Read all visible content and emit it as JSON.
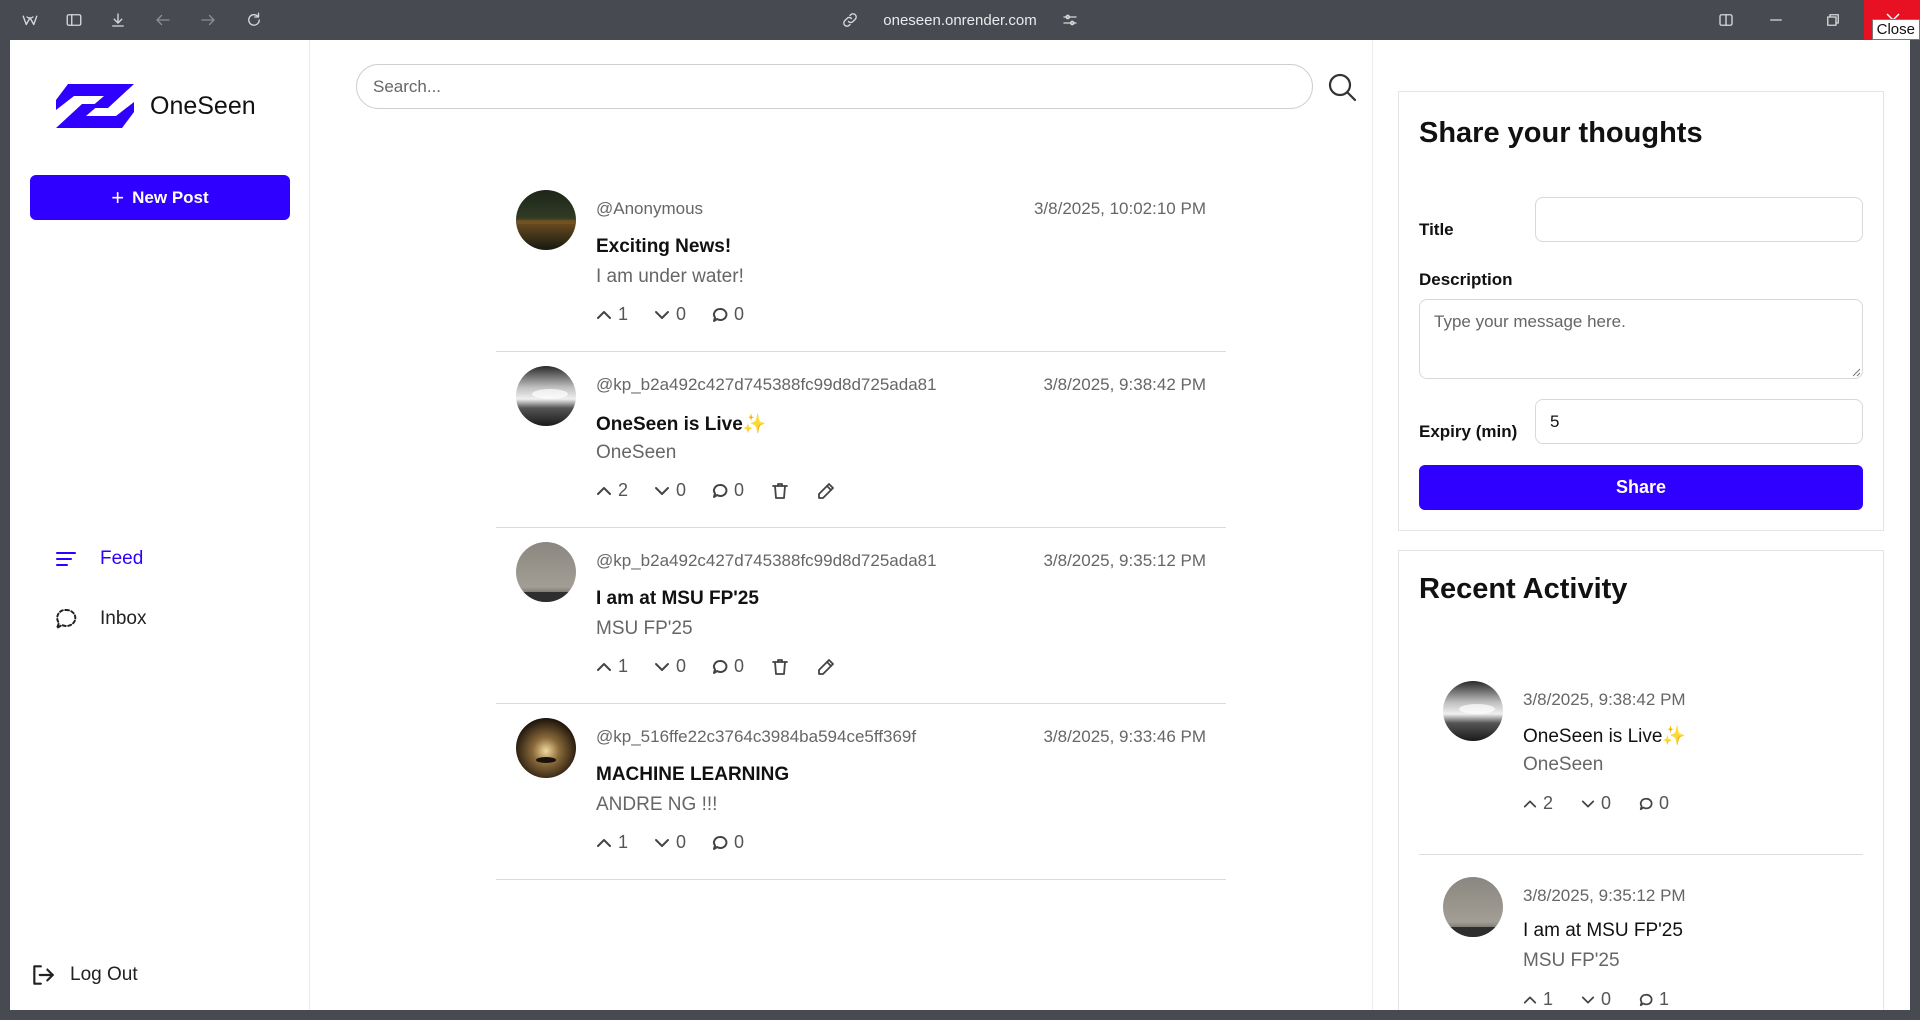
{
  "browser": {
    "url": "oneseen.onrender.com",
    "close_tooltip": "Close",
    "colors": {
      "chrome": "#474b51",
      "close": "#e81123"
    }
  },
  "sidebar": {
    "brand": "OneSeen",
    "new_post_label": "New Post",
    "nav": [
      {
        "label": "Feed",
        "icon": "menu-lines-icon",
        "active": true
      },
      {
        "label": "Inbox",
        "icon": "chat-bubble-icon",
        "active": false
      }
    ],
    "logout_label": "Log Out"
  },
  "search": {
    "placeholder": "Search..."
  },
  "posts": [
    {
      "author": "@Anonymous",
      "time": "3/8/2025, 10:02:10 PM",
      "title": "Exciting News!",
      "description": "I am under water!",
      "upvotes": "1",
      "downvotes": "0",
      "comments": "0",
      "can_edit": false
    },
    {
      "author": "@kp_b2a492c427d745388fc99d8d725ada81",
      "time": "3/8/2025, 9:38:42 PM",
      "title": "OneSeen is Live✨",
      "description": "OneSeen",
      "upvotes": "2",
      "downvotes": "0",
      "comments": "0",
      "can_edit": true
    },
    {
      "author": "@kp_b2a492c427d745388fc99d8d725ada81",
      "time": "3/8/2025, 9:35:12 PM",
      "title": "I am at MSU FP'25",
      "description": "MSU FP'25",
      "upvotes": "1",
      "downvotes": "0",
      "comments": "0",
      "can_edit": true
    },
    {
      "author": "@kp_516ffe22c3764c3984ba594ce5ff369f",
      "time": "3/8/2025, 9:33:46 PM",
      "title": "MACHINE LEARNING",
      "description": "ANDRE NG !!!",
      "upvotes": "1",
      "downvotes": "0",
      "comments": "0",
      "can_edit": false
    }
  ],
  "share": {
    "heading": "Share your thoughts",
    "title_label": "Title",
    "title_value": "",
    "description_label": "Description",
    "description_placeholder": "Type your message here.",
    "expiry_label": "Expiry (min)",
    "expiry_value": "5",
    "button_label": "Share"
  },
  "activity": {
    "heading": "Recent Activity",
    "items": [
      {
        "time": "3/8/2025, 9:38:42 PM",
        "title": "OneSeen is Live✨",
        "description": "OneSeen",
        "upvotes": "2",
        "downvotes": "0",
        "comments": "0"
      },
      {
        "time": "3/8/2025, 9:35:12 PM",
        "title": "I am at MSU FP'25",
        "description": "MSU FP'25",
        "upvotes": "1",
        "downvotes": "0",
        "comments": "1"
      }
    ]
  },
  "colors": {
    "accent": "#2f00ff",
    "muted_text": "#666666",
    "divider": "#dcdcdc"
  }
}
